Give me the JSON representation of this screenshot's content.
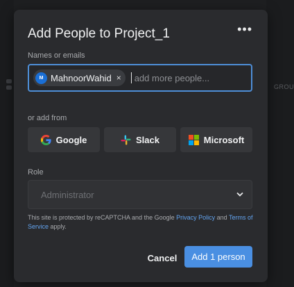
{
  "background": {
    "right_text": "GROU"
  },
  "modal": {
    "title": "Add People to Project_1",
    "more_label": "•••",
    "names_label": "Names or emails",
    "chip": {
      "initials": "M",
      "name": "MahnoorWahid",
      "remove": "×"
    },
    "input_placeholder": "add more people...",
    "add_from_label": "or add from",
    "providers": [
      {
        "label": "Google",
        "icon": "google-icon"
      },
      {
        "label": "Slack",
        "icon": "slack-icon"
      },
      {
        "label": "Microsoft",
        "icon": "microsoft-icon"
      }
    ],
    "role_label": "Role",
    "role_value": "Administrator",
    "recaptcha": {
      "prefix": "This site is protected by reCAPTCHA and the Google ",
      "privacy_link": "Privacy Policy",
      "middle": " and ",
      "terms_link": "Terms of Service",
      "suffix": " apply."
    },
    "cancel_label": "Cancel",
    "add_label": "Add 1 person"
  },
  "colors": {
    "accent": "#4a8fe2",
    "modal_bg": "#2a2b2e",
    "link": "#63a4f0"
  }
}
